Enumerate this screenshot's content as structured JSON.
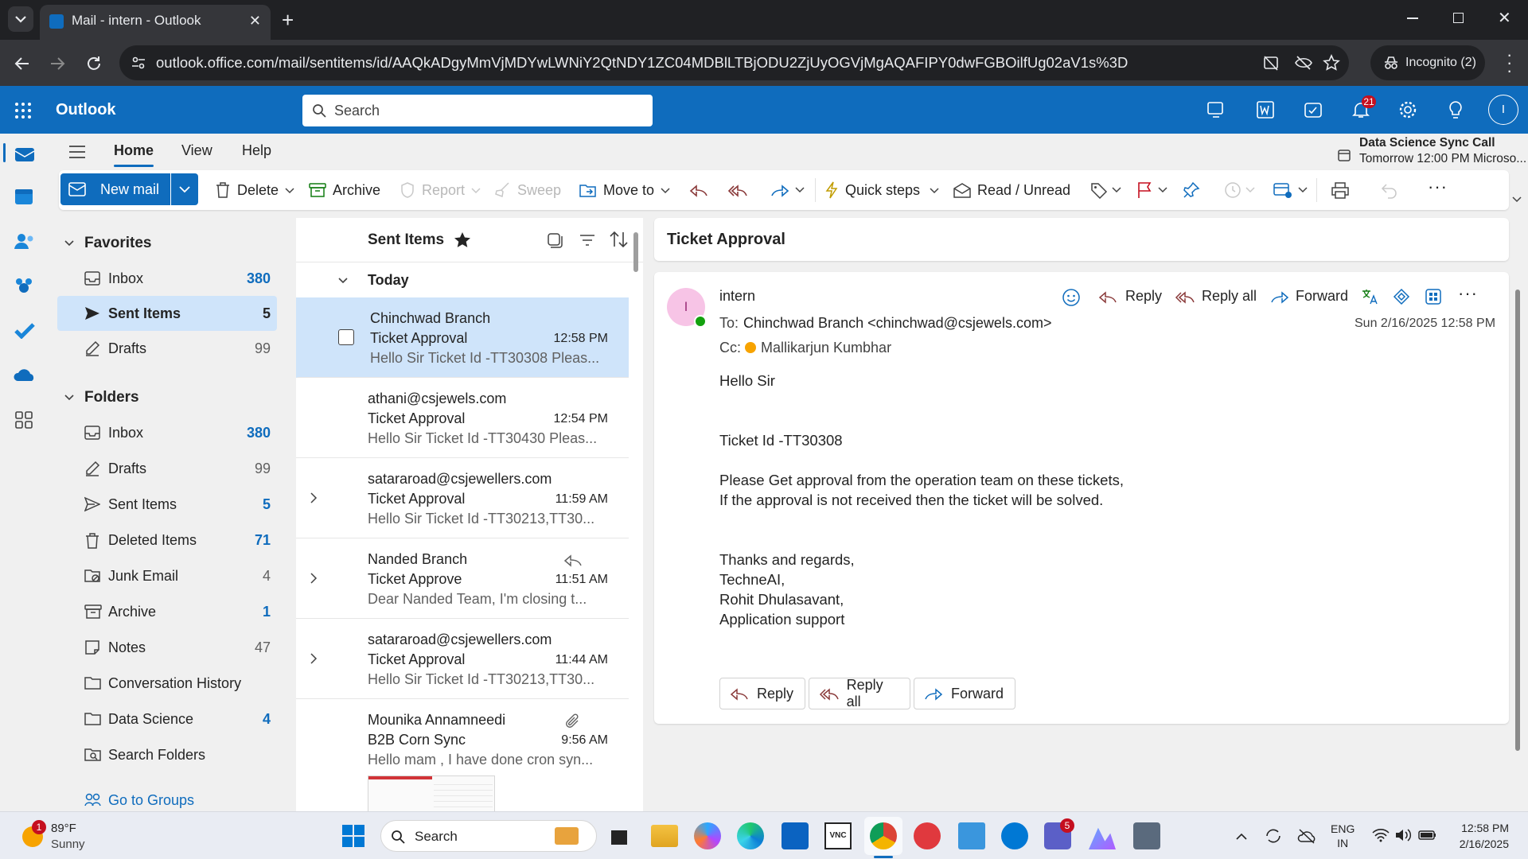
{
  "browser": {
    "tab_title": "Mail - intern - Outlook",
    "url": "outlook.office.com/mail/sentitems/id/AAQkADgyMmVjMDYwLWNiY2QtNDY1ZC04MDBlLTBjODU2ZjUyOGVjMgAQAFIPY0dwFGBOilfUg02aV1s%3D",
    "incognito_label": "Incognito (2)"
  },
  "header": {
    "app_name": "Outlook",
    "search_placeholder": "Search",
    "notification_count": "21",
    "avatar_initial": "I",
    "event_title": "Data Science Sync Call",
    "event_time": "Tomorrow 12:00 PM Microso..."
  },
  "ribbon_tabs": [
    "Home",
    "View",
    "Help"
  ],
  "ribbon": {
    "new_mail": "New mail",
    "delete": "Delete",
    "archive": "Archive",
    "report": "Report",
    "sweep": "Sweep",
    "move_to": "Move to",
    "quick_steps": "Quick steps",
    "read_unread": "Read / Unread"
  },
  "folders": {
    "favorites_label": "Favorites",
    "folders_label": "Folders",
    "favorites": [
      {
        "name": "Inbox",
        "count": "380"
      },
      {
        "name": "Sent Items",
        "count": "5"
      },
      {
        "name": "Drafts",
        "count": "99"
      }
    ],
    "items": [
      {
        "name": "Inbox",
        "count": "380"
      },
      {
        "name": "Drafts",
        "count": "99"
      },
      {
        "name": "Sent Items",
        "count": "5"
      },
      {
        "name": "Deleted Items",
        "count": "71"
      },
      {
        "name": "Junk Email",
        "count": "4"
      },
      {
        "name": "Archive",
        "count": "1"
      },
      {
        "name": "Notes",
        "count": "47"
      },
      {
        "name": "Conversation History",
        "count": ""
      },
      {
        "name": "Data Science",
        "count": "4"
      },
      {
        "name": "Search Folders",
        "count": ""
      }
    ],
    "go_to_groups": "Go to Groups"
  },
  "message_list": {
    "title": "Sent Items",
    "group": "Today",
    "messages": [
      {
        "sender": "Chinchwad Branch",
        "subject": "Ticket Approval",
        "time": "12:58 PM",
        "preview": "Hello Sir Ticket Id -TT30308 Pleas..."
      },
      {
        "sender": "athani@csjewels.com",
        "subject": "Ticket Approval",
        "time": "12:54 PM",
        "preview": "Hello Sir Ticket Id -TT30430 Pleas..."
      },
      {
        "sender": "satararoad@csjewellers.com",
        "subject": "Ticket Approval",
        "time": "11:59 AM",
        "preview": "Hello Sir Ticket Id -TT30213,TT30..."
      },
      {
        "sender": "Nanded Branch",
        "subject": "Ticket Approve",
        "time": "11:51 AM",
        "preview": "Dear Nanded Team, I'm closing t..."
      },
      {
        "sender": "satararoad@csjewellers.com",
        "subject": "Ticket Approval",
        "time": "11:44 AM",
        "preview": "Hello Sir Ticket Id -TT30213,TT30..."
      },
      {
        "sender": "Mounika Annamneedi",
        "subject": "B2B Corn Sync",
        "time": "9:56 AM",
        "preview": "Hello mam , I have done cron syn..."
      }
    ]
  },
  "reading_pane": {
    "subject": "Ticket Approval",
    "from": "intern",
    "sender_initial": "I",
    "to_label": "To:",
    "to": "Chinchwad Branch <chinchwad@csjewels.com>",
    "cc_label": "Cc:",
    "cc": "Mallikarjun Kumbhar",
    "date": "Sun 2/16/2025 12:58 PM",
    "reply": "Reply",
    "reply_all": "Reply all",
    "forward": "Forward",
    "body": [
      "Hello Sir",
      "Ticket Id -TT30308",
      "Please Get approval from the operation team on these tickets,",
      "If the approval is not received then the ticket will be solved.",
      "Thanks and regards,",
      "TechneAI,",
      "Rohit Dhulasavant,",
      "Application support"
    ]
  },
  "taskbar": {
    "weather_temp": "89°F",
    "weather_desc": "Sunny",
    "weather_badge": "1",
    "search_label": "Search",
    "teams_badge": "5",
    "lang1": "ENG",
    "lang2": "IN",
    "time": "12:58 PM",
    "date": "2/16/2025"
  }
}
